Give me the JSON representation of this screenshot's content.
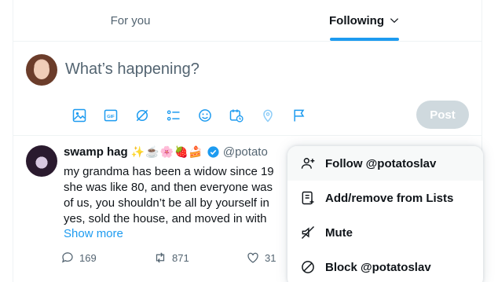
{
  "tabs": [
    {
      "label": "For you",
      "active": false
    },
    {
      "label": "Following",
      "active": true,
      "has_dropdown": true
    }
  ],
  "composer": {
    "placeholder": "What’s happening?",
    "post_label": "Post",
    "tools": [
      "media-icon",
      "gif-icon",
      "grok-icon",
      "poll-icon",
      "emoji-icon",
      "schedule-icon",
      "location-icon",
      "flag-icon"
    ]
  },
  "tweet": {
    "name": "swamp hag",
    "name_emoji": "✨☕🌸🍓🍰",
    "handle": "@potato",
    "body_lines": [
      "my grandma has been a widow since 19",
      "she was like 80, and then everyone was",
      "of us, you shouldn’t be all by yourself in",
      "yes, sold the house, and moved in with"
    ],
    "show_more": "Show more",
    "replies": "169",
    "reposts": "871",
    "likes": "31"
  },
  "menu": {
    "items": [
      {
        "label": "Follow @potatoslav",
        "icon": "follow-icon"
      },
      {
        "label": "Add/remove from Lists",
        "icon": "list-add-icon"
      },
      {
        "label": "Mute",
        "icon": "mute-icon"
      },
      {
        "label": "Block @potatoslav",
        "icon": "block-icon"
      }
    ]
  },
  "colors": {
    "accent": "#1d9bf0",
    "muted": "#536471",
    "post_disabled": "#cfd9de"
  }
}
